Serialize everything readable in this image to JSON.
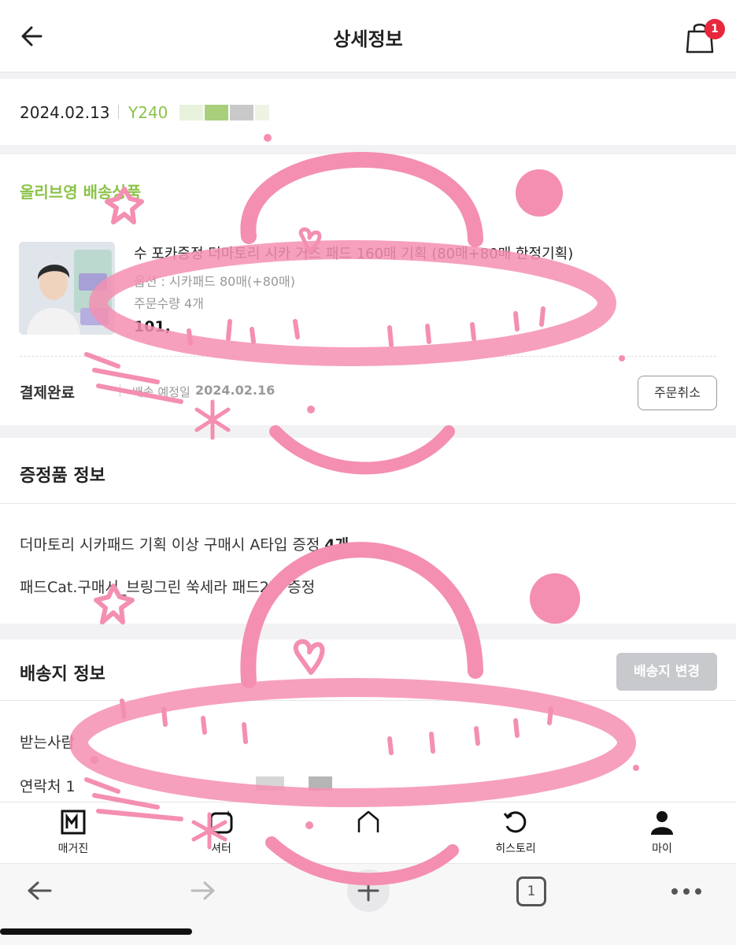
{
  "header": {
    "title": "상세정보",
    "cart_count": "1"
  },
  "order": {
    "date": "2024.02.13",
    "number": "Y240"
  },
  "shipping": {
    "title": "올리브영 배송상품",
    "product": {
      "name": "수 포카증정 더마토리 시카 거즈 패드 160매 기획 (80매+80매 한정기획)",
      "option": "옵션 : 시카패드 80매(+80매)",
      "qty": "주문수량 4개",
      "price": "101,"
    },
    "status": "결제완료",
    "eta_label": "배송 예정일",
    "eta_date": "2024.02.16",
    "cancel_label": "주문취소"
  },
  "gift": {
    "title": "증정품 정보",
    "items": [
      {
        "text": "더마토리 시카패드 기획 이상 구매시 A타입 증정",
        "count": "4개"
      },
      {
        "text": "패드Cat.구매시_브링그린 쑥세라 패드2매 증정",
        "count": ""
      }
    ]
  },
  "address": {
    "title": "배송지 정보",
    "change_label": "배송지 변경",
    "recipient_label": "받는사람",
    "phone_label": "연락처 1"
  },
  "tabbar": {
    "items": [
      {
        "label": "매거진",
        "icon": "magazine-icon"
      },
      {
        "label": "셔터",
        "icon": "shutter-icon"
      },
      {
        "label": "",
        "icon": "home-icon"
      },
      {
        "label": "히스토리",
        "icon": "history-icon"
      },
      {
        "label": "마이",
        "icon": "person-icon"
      }
    ]
  },
  "browser": {
    "tab_count": "1"
  },
  "colors": {
    "accent": "#8bc34a",
    "badge": "#e8263c",
    "doodle": "#f48fb1"
  }
}
